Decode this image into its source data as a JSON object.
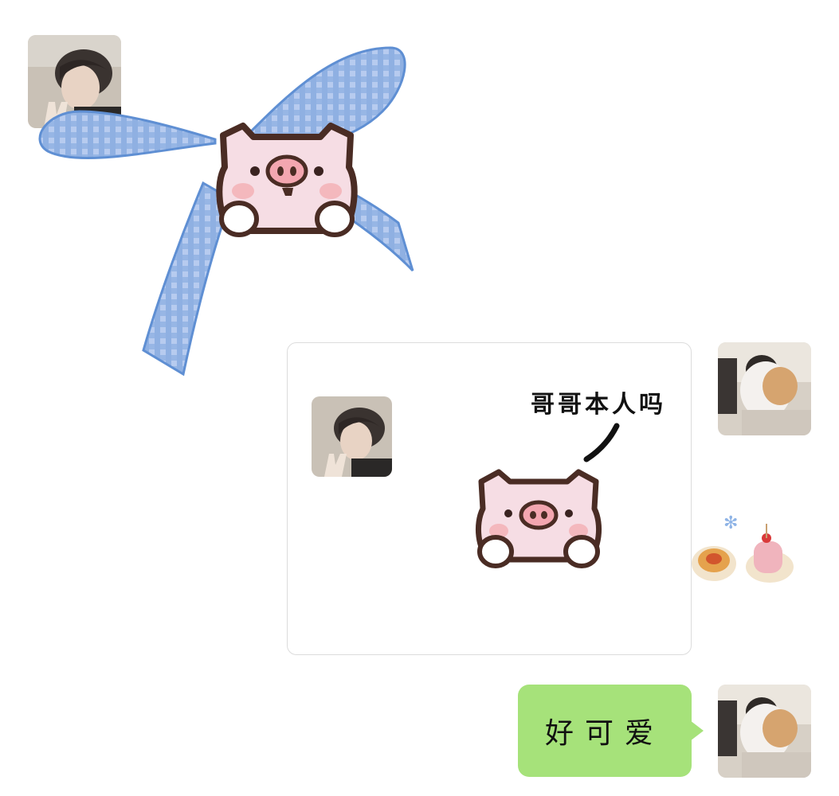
{
  "chat": {
    "card_caption": "哥哥本人吗",
    "bubble_text": "好可爱"
  },
  "colors": {
    "bubble": "#a6e27a",
    "ribbon": "#7ea6dc",
    "pig_face": "#f6dde4",
    "pig_outline": "#4a2c24"
  },
  "icons": {
    "sticker_bow": "pig-with-blue-ribbon",
    "sticker_food": "tea-and-dessert",
    "card_pig": "pig-face"
  }
}
